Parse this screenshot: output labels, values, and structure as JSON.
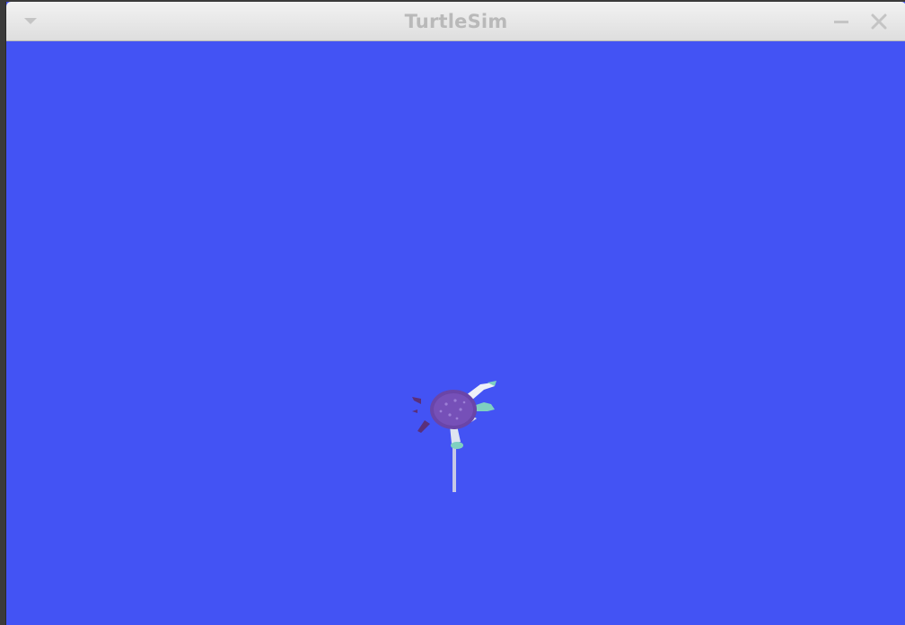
{
  "window": {
    "title": "TurtleSim"
  },
  "icons": {
    "menu": "chevron-down-icon",
    "minimize": "minimize-icon",
    "close": "close-icon",
    "turtle": "turtle-icon"
  },
  "colors": {
    "background": "#4353f4",
    "pen_trail": "#c6c8e6",
    "turtle_shell": "#6a45a8",
    "turtle_body": "#5a2f7a",
    "turtle_flipper": "#7fd0c0"
  }
}
